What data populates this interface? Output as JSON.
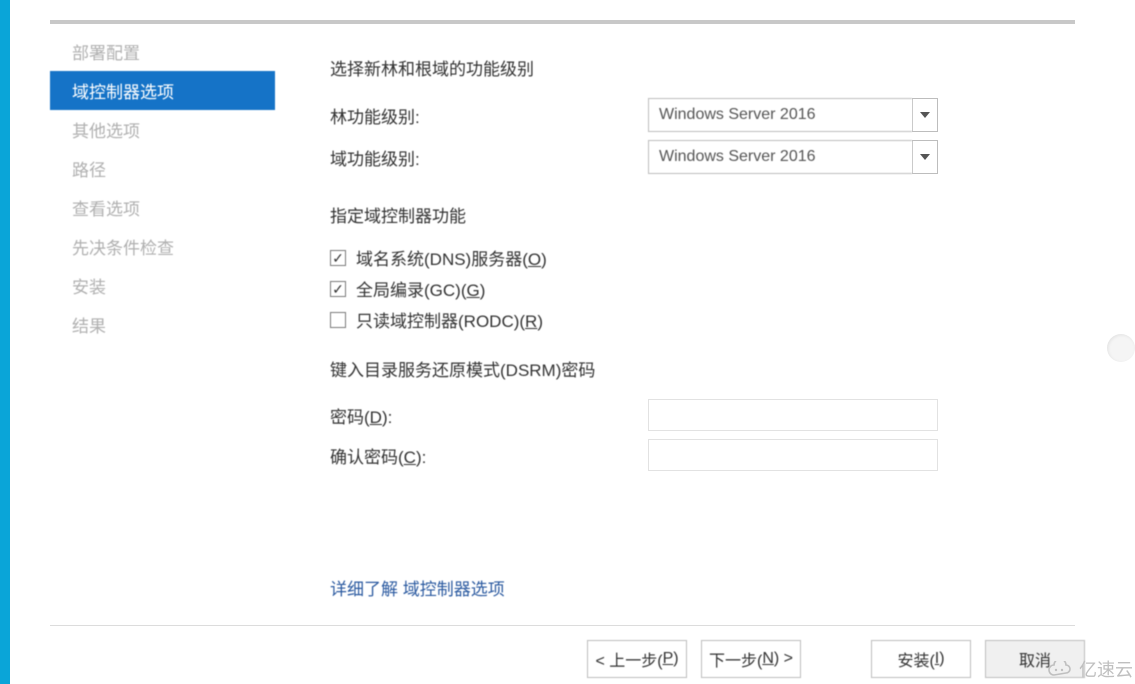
{
  "sidebar": {
    "items": [
      {
        "label": "部署配置"
      },
      {
        "label": "域控制器选项"
      },
      {
        "label": "其他选项"
      },
      {
        "label": "路径"
      },
      {
        "label": "查看选项"
      },
      {
        "label": "先决条件检查"
      },
      {
        "label": "安装"
      },
      {
        "label": "结果"
      }
    ],
    "selected_index": 1
  },
  "main": {
    "section1_title": "选择新林和根域的功能级别",
    "forest_level_label": "林功能级别:",
    "domain_level_label": "域功能级别:",
    "forest_level_value": "Windows Server 2016",
    "domain_level_value": "Windows Server 2016",
    "section2_title": "指定域控制器功能",
    "dns_label_pre": "域名系统(DNS)服务器(",
    "dns_hotkey": "O",
    "dns_label_post": ")",
    "gc_label_pre": "全局编录(GC)(",
    "gc_hotkey": "G",
    "gc_label_post": ")",
    "rodc_label_pre": "只读域控制器(RODC)(",
    "rodc_hotkey": "R",
    "rodc_label_post": ")",
    "dns_checked": true,
    "gc_checked": true,
    "rodc_checked": false,
    "section3_title": "键入目录服务还原模式(DSRM)密码",
    "password_label_pre": "密码(",
    "password_hotkey": "D",
    "password_label_post": "):",
    "confirm_label_pre": "确认密码(",
    "confirm_hotkey": "C",
    "confirm_label_post": "):",
    "password_value": "",
    "confirm_value": "",
    "learn_more_text": "详细了解 域控制器选项"
  },
  "buttons": {
    "previous_pre": "< 上一步(",
    "previous_hotkey": "P",
    "previous_post": ")",
    "next_pre": "下一步(",
    "next_hotkey": "N",
    "next_post": ") >",
    "install_pre": "安装(",
    "install_hotkey": "I",
    "install_post": ")",
    "cancel": "取消"
  },
  "watermark": {
    "text": "亿速云"
  }
}
